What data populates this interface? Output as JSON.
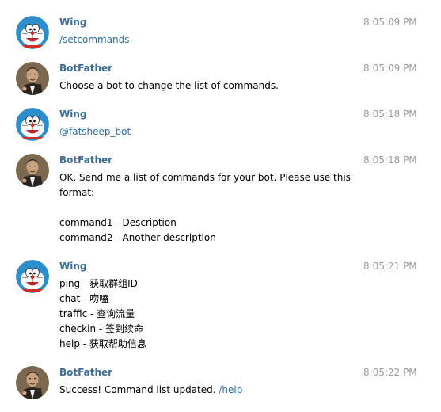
{
  "messages": [
    {
      "sender": "Wing",
      "avatar": "doraemon-avatar",
      "time": "8:05:09 PM",
      "lines": [
        {
          "text": "/setcommands",
          "command": true
        }
      ]
    },
    {
      "sender": "BotFather",
      "avatar": "botfather-avatar",
      "time": "8:05:09 PM",
      "lines": [
        {
          "text": "Choose a bot to change the list of commands."
        }
      ]
    },
    {
      "sender": "Wing",
      "avatar": "doraemon-avatar",
      "time": "8:05:18 PM",
      "lines": [
        {
          "text": "@fatsheep_bot",
          "command": true
        }
      ]
    },
    {
      "sender": "BotFather",
      "avatar": "botfather-avatar",
      "time": "8:05:18 PM",
      "lines": [
        {
          "text": "OK. Send me a list of commands for your bot. Please use this"
        },
        {
          "text": "format:"
        },
        {
          "text": ""
        },
        {
          "text": "command1 - Description"
        },
        {
          "text": "command2 - Another description"
        }
      ]
    },
    {
      "sender": "Wing",
      "avatar": "doraemon-avatar",
      "time": "8:05:21 PM",
      "lines": [
        {
          "text": "ping - 获取群组ID"
        },
        {
          "text": "chat - 唠嗑"
        },
        {
          "text": "traffic - 查询流量"
        },
        {
          "text": "checkin - 签到续命"
        },
        {
          "text": "help - 获取帮助信息"
        }
      ]
    },
    {
      "sender": "BotFather",
      "avatar": "botfather-avatar",
      "time": "8:05:22 PM",
      "lines": [
        {
          "text": "Success! Command list updated. ",
          "suffix": "/help"
        }
      ]
    }
  ],
  "colors": {
    "sender": "#3a6d99",
    "time": "#999999",
    "command": "#2f6ea5"
  }
}
